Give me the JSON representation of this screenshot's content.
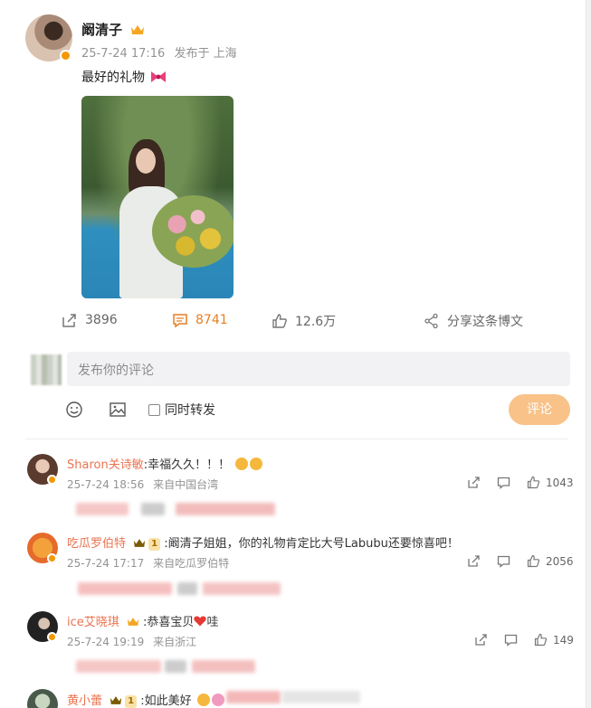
{
  "post": {
    "author": "阚清子",
    "date": "25-7-24 17:16",
    "source": "发布于 上海",
    "text": "最好的礼物"
  },
  "actions": {
    "repost_count": "3896",
    "comment_count": "8741",
    "like_count": "12.6万",
    "share_label": "分享这条博文"
  },
  "composer": {
    "placeholder": "发布你的评论",
    "forward_label": "同时转发",
    "submit_label": "评论"
  },
  "colors": {
    "accent": "#e67e22",
    "name_link": "#eb7350",
    "submit_bg": "#f9c288",
    "verified_badge": "#f39800"
  },
  "comments": [
    {
      "name": "Sharon关诗敏",
      "text": ":幸福久久！！！",
      "date": "25-7-24 18:56",
      "location": "来自中国台湾",
      "likes": "1043"
    },
    {
      "name": "吃瓜罗伯特",
      "badge": "1",
      "text": ":阚清子姐姐，你的礼物肯定比大号Labubu还要惊喜吧！",
      "date": "25-7-24 17:17",
      "location": "来自吃瓜罗伯特",
      "likes": "2056"
    },
    {
      "name": "ice艾晓琪",
      "text": ":恭喜宝贝",
      "text_suffix": "哇",
      "date": "25-7-24 19:19",
      "location": "来自浙江",
      "likes": "149"
    },
    {
      "name": "黄小蕾",
      "badge": "1",
      "text": ":如此美好"
    }
  ]
}
